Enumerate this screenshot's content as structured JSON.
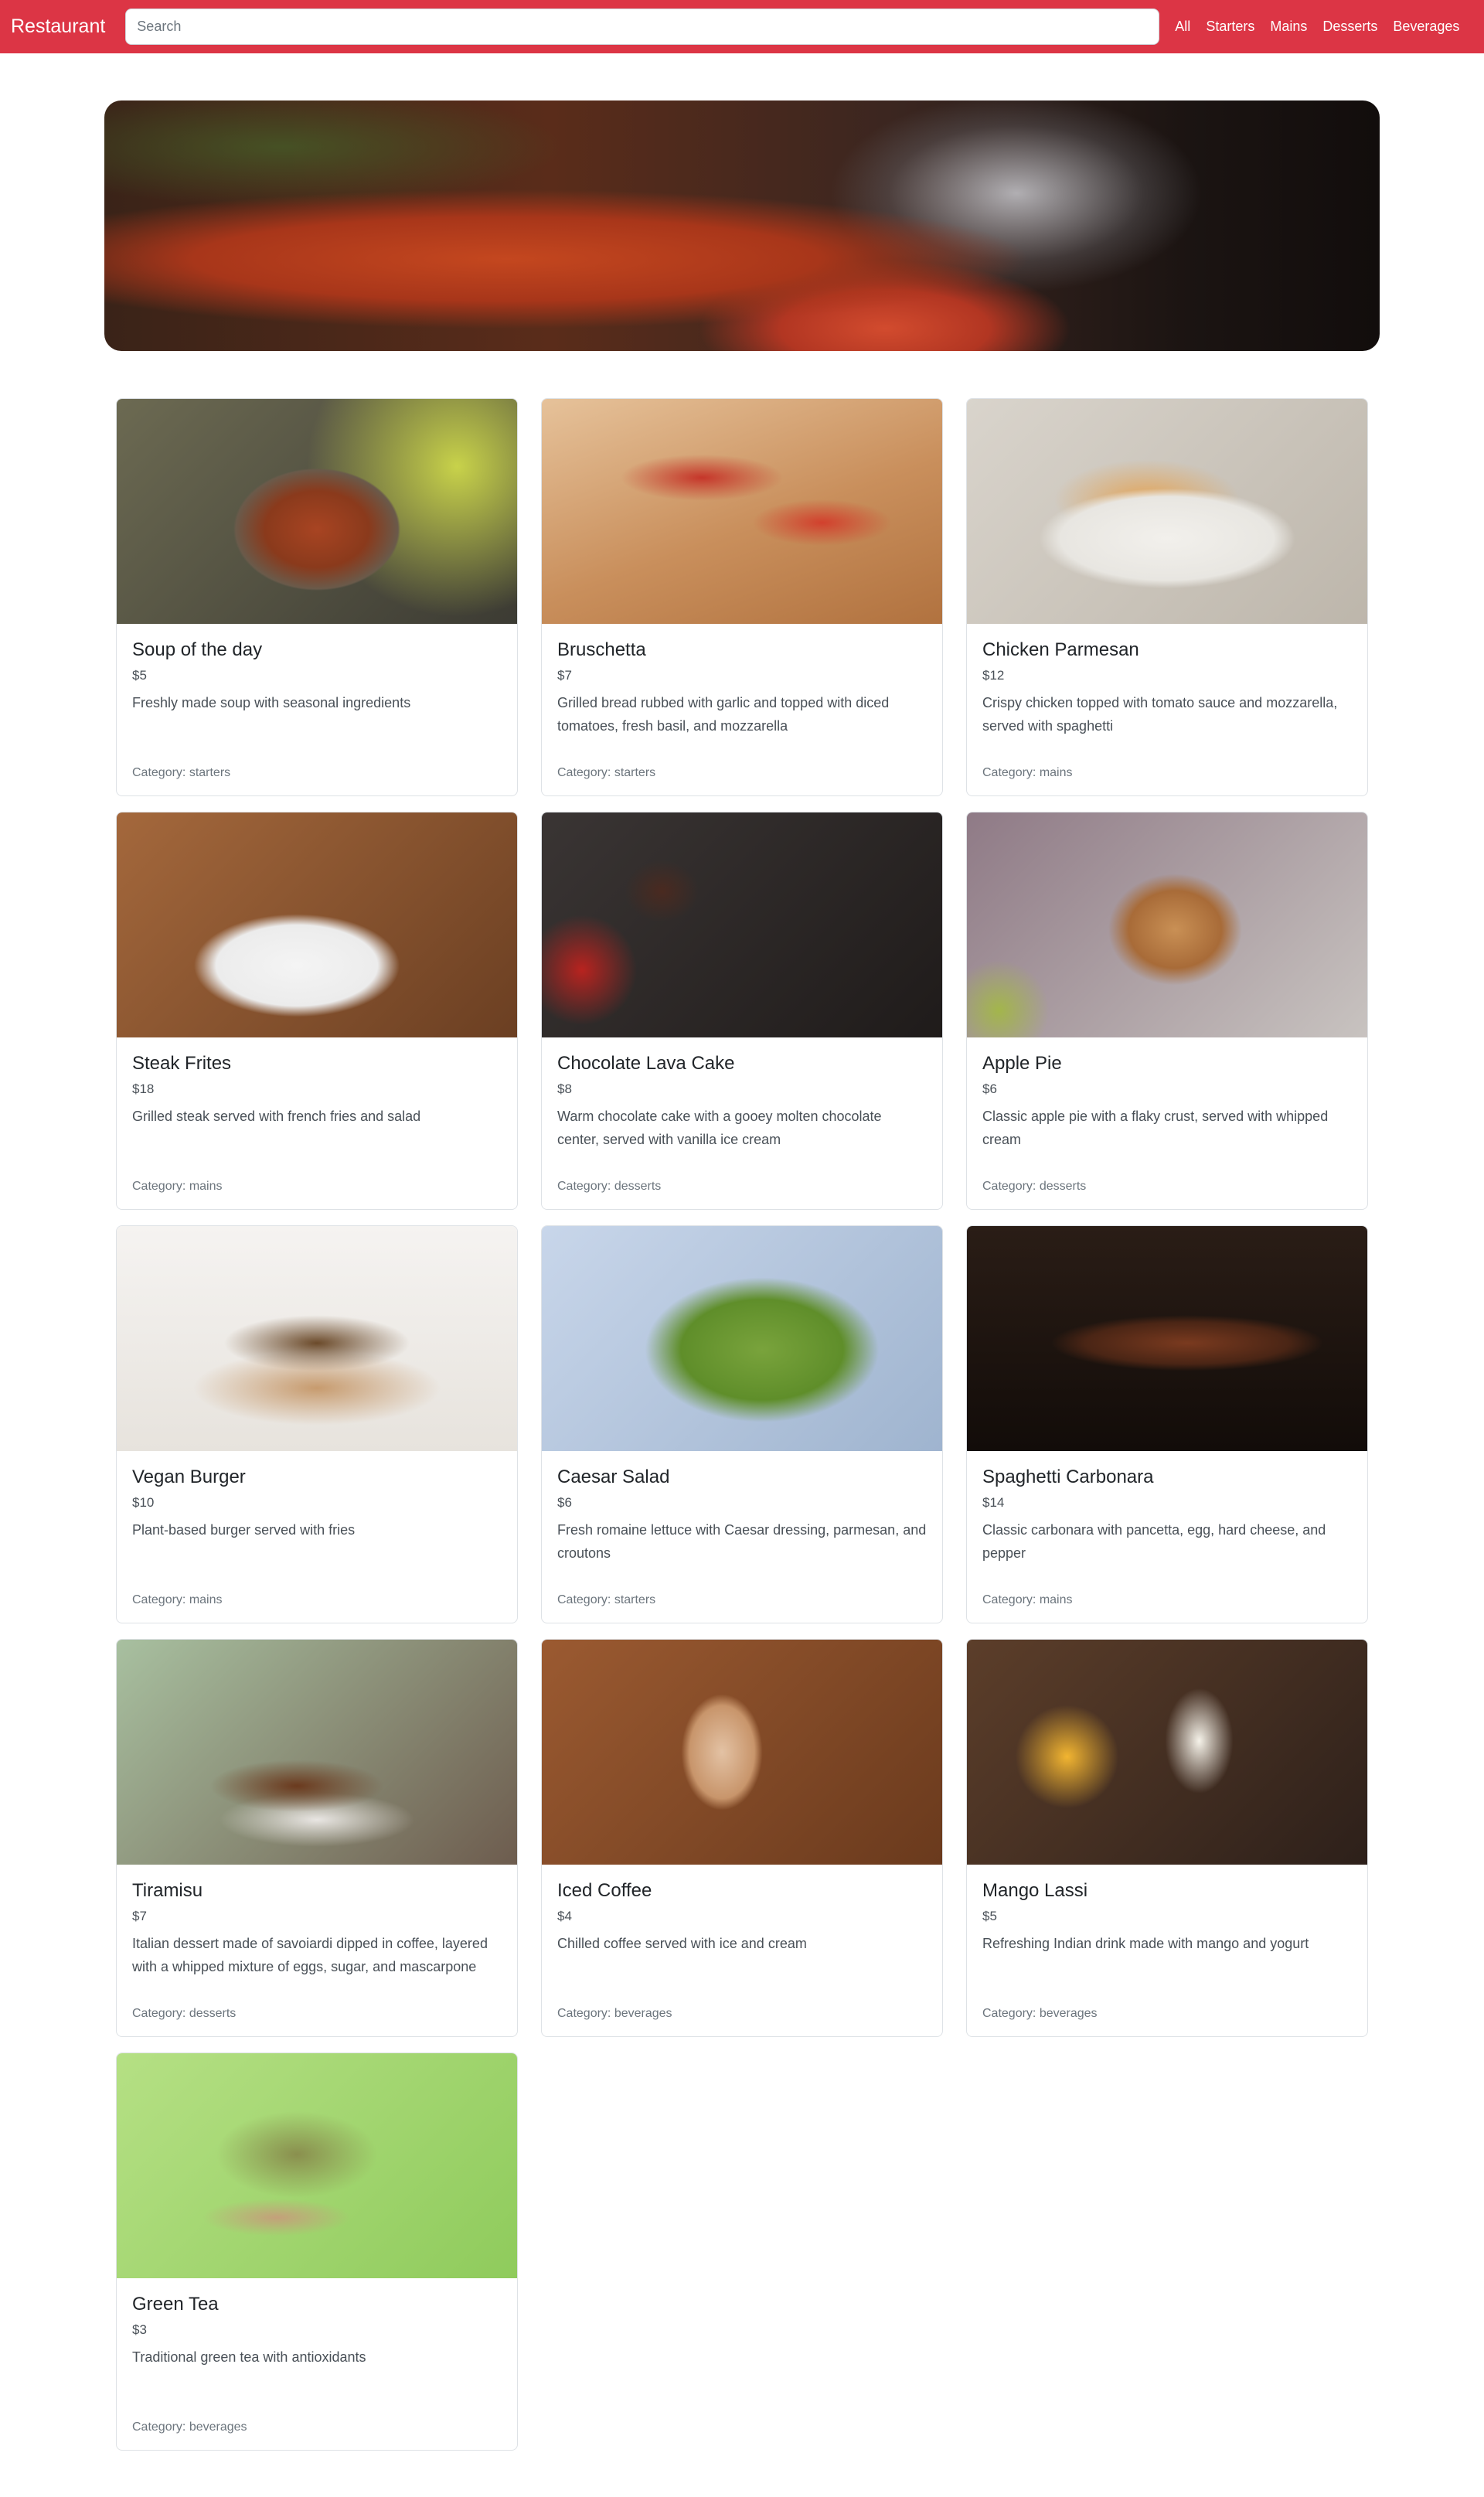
{
  "navbar": {
    "brand": "Restaurant",
    "search_placeholder": "Search",
    "links": [
      "All",
      "Starters",
      "Mains",
      "Desserts",
      "Beverages"
    ]
  },
  "colors": {
    "navbar": "#dc3545",
    "card_border": "#dee2e6",
    "muted_text": "#6c757d"
  },
  "menu_items": [
    {
      "name": "Soup of the day",
      "price": "$5",
      "description": "Freshly made soup with seasonal ingredients",
      "category": "Category: starters"
    },
    {
      "name": "Bruschetta",
      "price": "$7",
      "description": "Grilled bread rubbed with garlic and topped with diced tomatoes, fresh basil, and mozzarella",
      "category": "Category: starters"
    },
    {
      "name": "Chicken Parmesan",
      "price": "$12",
      "description": "Crispy chicken topped with tomato sauce and mozzarella, served with spaghetti",
      "category": "Category: mains"
    },
    {
      "name": "Steak Frites",
      "price": "$18",
      "description": "Grilled steak served with french fries and salad",
      "category": "Category: mains"
    },
    {
      "name": "Chocolate Lava Cake",
      "price": "$8",
      "description": "Warm chocolate cake with a gooey molten chocolate center, served with vanilla ice cream",
      "category": "Category: desserts"
    },
    {
      "name": "Apple Pie",
      "price": "$6",
      "description": "Classic apple pie with a flaky crust, served with whipped cream",
      "category": "Category: desserts"
    },
    {
      "name": "Vegan Burger",
      "price": "$10",
      "description": "Plant-based burger served with fries",
      "category": "Category: mains"
    },
    {
      "name": "Caesar Salad",
      "price": "$6",
      "description": "Fresh romaine lettuce with Caesar dressing, parmesan, and croutons",
      "category": "Category: starters"
    },
    {
      "name": "Spaghetti Carbonara",
      "price": "$14",
      "description": "Classic carbonara with pancetta, egg, hard cheese, and pepper",
      "category": "Category: mains"
    },
    {
      "name": "Tiramisu",
      "price": "$7",
      "description": "Italian dessert made of savoiardi dipped in coffee, layered with a whipped mixture of eggs, sugar, and mascarpone",
      "category": "Category: desserts"
    },
    {
      "name": "Iced Coffee",
      "price": "$4",
      "description": "Chilled coffee served with ice and cream",
      "category": "Category: beverages"
    },
    {
      "name": "Mango Lassi",
      "price": "$5",
      "description": "Refreshing Indian drink made with mango and yogurt",
      "category": "Category: beverages"
    },
    {
      "name": "Green Tea",
      "price": "$3",
      "description": "Traditional green tea with antioxidants",
      "category": "Category: beverages"
    }
  ]
}
